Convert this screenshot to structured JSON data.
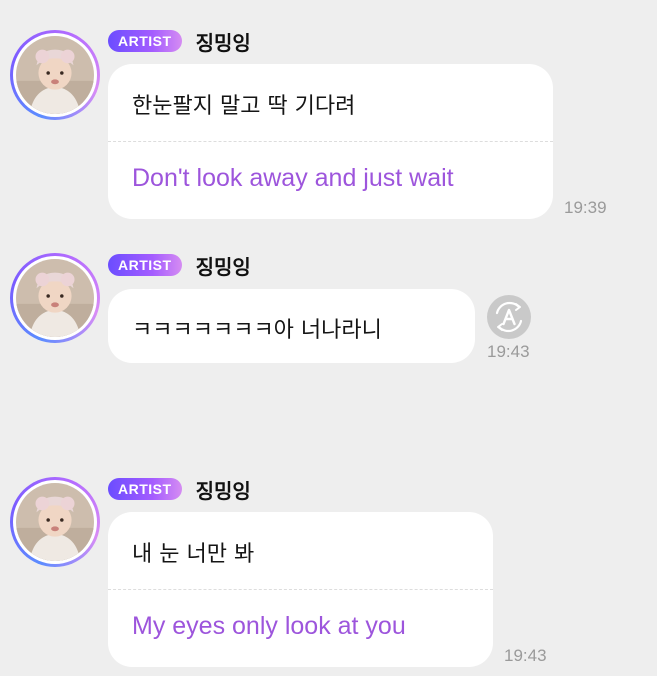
{
  "messages": [
    {
      "badge": "ARTIST",
      "name": "징밍잉",
      "text": "한눈팔지 말고 딱 기다려",
      "translation": "Don't look away and just wait",
      "time": "19:39"
    },
    {
      "badge": "ARTIST",
      "name": "징밍잉",
      "text": "ㅋㅋㅋㅋㅋㅋㅋ아 너나라니",
      "time": "19:43",
      "translate_icon": "translate-icon"
    },
    {
      "badge": "ARTIST",
      "name": "징밍잉",
      "text": "내 눈 너만 봐",
      "translation": "My eyes only look at you",
      "time": "19:43"
    }
  ],
  "colors": {
    "background": "#eeeeee",
    "bubble": "#ffffff",
    "translation_text": "#9d55dc",
    "badge_gradient_start": "#6b4dff",
    "badge_gradient_end": "#d58cf2",
    "timestamp": "#9a9a9a"
  }
}
